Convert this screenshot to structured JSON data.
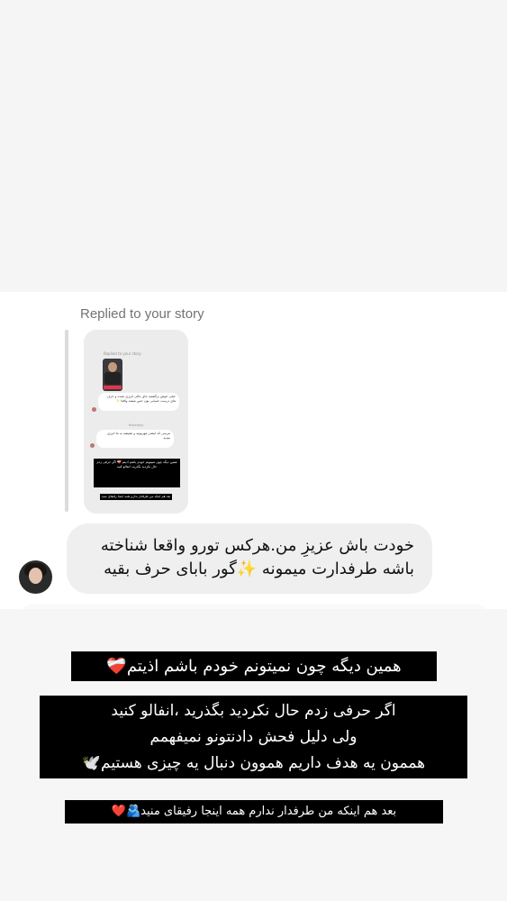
{
  "chat": {
    "replied_label": "Replied to your story",
    "message": "خودت باش عزیزِ من.هرکس تورو واقعا شناخته باشه طرفدارت میمونه ✨گور بابای حرف بقیه"
  },
  "story_thumbnail": {
    "replied_label": "Replied to your story",
    "bubble1": "خیلی خوش برگشتید جای خالی انرژی مثبت و حرف های درست حسابی تون حس میشد واقعا ✨",
    "time": "Yesterday",
    "bubble2": "مرسی که اینقدر مهربونید و همیشه به ما انرژی میدید",
    "black_text": "همین دیگه چون نمیتونم خودم باشم اذیتم ❤️‍🩹 اگر حرفی زدم حال نکردید بگذرید، انفالو کنید",
    "black_text2": "بعد هم اینکه من طرفدار ندارم همه اینجا رفیقای منید"
  },
  "story": {
    "caption1": "همین دیگه چون نمیتونم خودم باشم اذیتم❤️‍🩹",
    "caption2_line1": "اگر حرفی زدم حال نکردید بگذرید ،انفالو کنید",
    "caption2_line2": "ولی دلیل فحش دادنتونو نمیفهمم",
    "caption2_line3": "هممون یه هدف داریم هموون دنبال یه چیزی هستیم🕊️",
    "caption3": "بعد هم اینکه من طرفدار ندارم همه اینجا رفیقای منید🫂❤️"
  }
}
